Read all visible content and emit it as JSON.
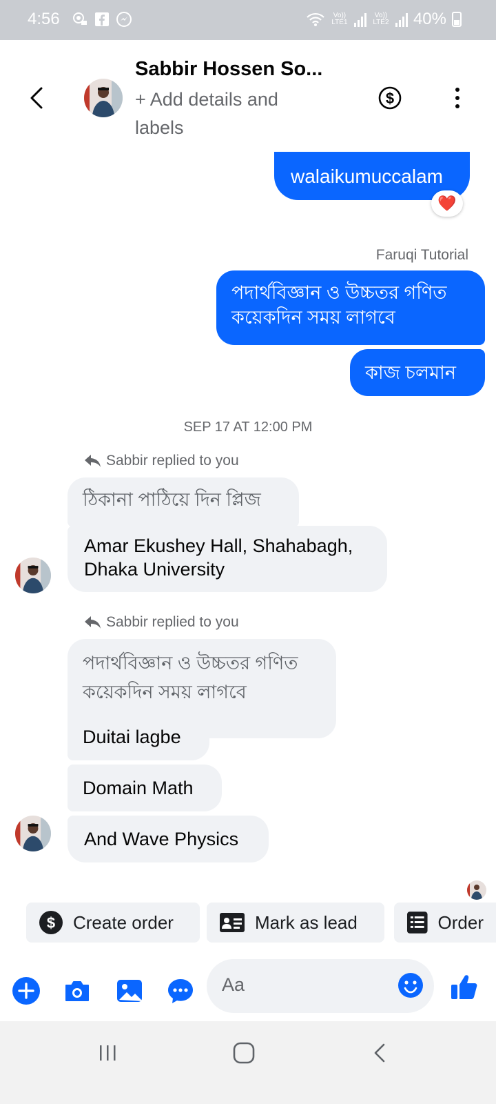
{
  "status_bar": {
    "time": "4:56",
    "battery": "40%",
    "sim1_label": "Vo)) LTE1",
    "sim2_label": "Vo)) LTE2"
  },
  "header": {
    "name": "Sabbir Hossen So...",
    "subtitle": "+ Add details and labels"
  },
  "messages": {
    "out1": "walaikumuccalam",
    "reaction": "❤️",
    "out_sender": "Faruqi Tutorial",
    "out2": "পদার্থবিজ্ঞান ও উচ্চতর গণিত কয়েকদিন সময় লাগবে",
    "out3": "কাজ চলমান",
    "timestamp": "SEP 17 AT 12:00 PM",
    "reply1_label": "Sabbir replied to you",
    "reply1_quote": "ঠিকানা পাঠিয়ে দিন প্লিজ",
    "reply1_text": "Amar Ekushey Hall, Shahabagh, Dhaka University",
    "reply2_label": "Sabbir replied to you",
    "reply2_quote": "পদার্থবিজ্ঞান ও উচ্চতর গণিত কয়েকদিন সময় লাগবে",
    "reply2_text": "Duitai lagbe",
    "in3": "Domain Math",
    "in4": "And Wave Physics"
  },
  "quick_actions": [
    {
      "label": "Create order",
      "icon": "dollar-circle-icon"
    },
    {
      "label": "Mark as lead",
      "icon": "id-card-icon"
    },
    {
      "label": "Order",
      "icon": "order-list-icon"
    }
  ],
  "composer": {
    "placeholder": "Aa"
  },
  "colors": {
    "accent": "#0a66ff",
    "incoming_bubble": "#f0f2f5",
    "status_bar": "#c9ccd1"
  }
}
